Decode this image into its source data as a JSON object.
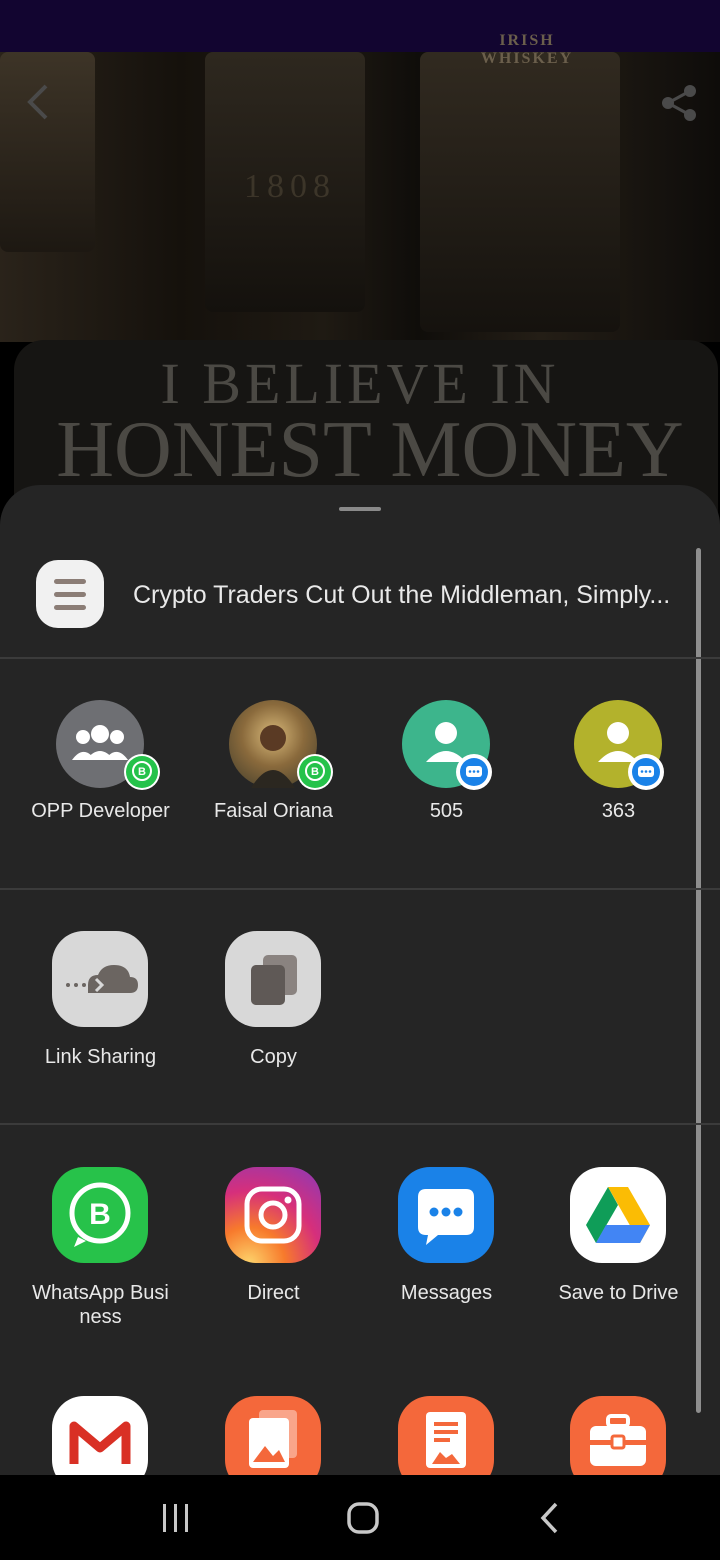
{
  "background": {
    "bottle_label": "IRISH WHISKEY",
    "bottle_year": "1808",
    "headline_line1": "I BELIEVE IN",
    "headline_line2": "HONEST MONEY"
  },
  "share_sheet": {
    "title": "Crypto Traders Cut Out the Middleman, Simply...",
    "contacts": [
      {
        "label": "OPP Developer",
        "avatar": "group-avatar-icon",
        "badge": "whatsapp-business-badge-icon",
        "color": "#6e6f73"
      },
      {
        "label": "Faisal Oriana",
        "avatar": "photo-avatar",
        "badge": "whatsapp-business-badge-icon",
        "color": "#8a6a3c"
      },
      {
        "label": "505",
        "avatar": "person-avatar-icon",
        "badge": "messages-badge-icon",
        "color": "#3db58c"
      },
      {
        "label": "363",
        "avatar": "person-avatar-icon",
        "badge": "messages-badge-icon",
        "color": "#b3b22c"
      }
    ],
    "quick_actions": [
      {
        "label": "Link Sharing",
        "icon": "cloud-link-icon"
      },
      {
        "label": "Copy",
        "icon": "copy-icon"
      }
    ],
    "apps": [
      {
        "label": "WhatsApp Busi\nness",
        "icon": "whatsapp-business-icon",
        "color": "#27c24a"
      },
      {
        "label": "Direct",
        "icon": "instagram-icon",
        "color": "#d62f7b"
      },
      {
        "label": "Messages",
        "icon": "messages-icon",
        "color": "#1a82e8"
      },
      {
        "label": "Save to Drive",
        "icon": "google-drive-icon",
        "color": "#ffffff"
      }
    ],
    "apps_row2": [
      {
        "icon": "gmail-icon",
        "color": "#ffffff"
      },
      {
        "icon": "gallery-icon",
        "color": "#f4683b"
      },
      {
        "icon": "document-image-icon",
        "color": "#f4683b"
      },
      {
        "icon": "toolbox-icon",
        "color": "#f4683b"
      }
    ]
  }
}
